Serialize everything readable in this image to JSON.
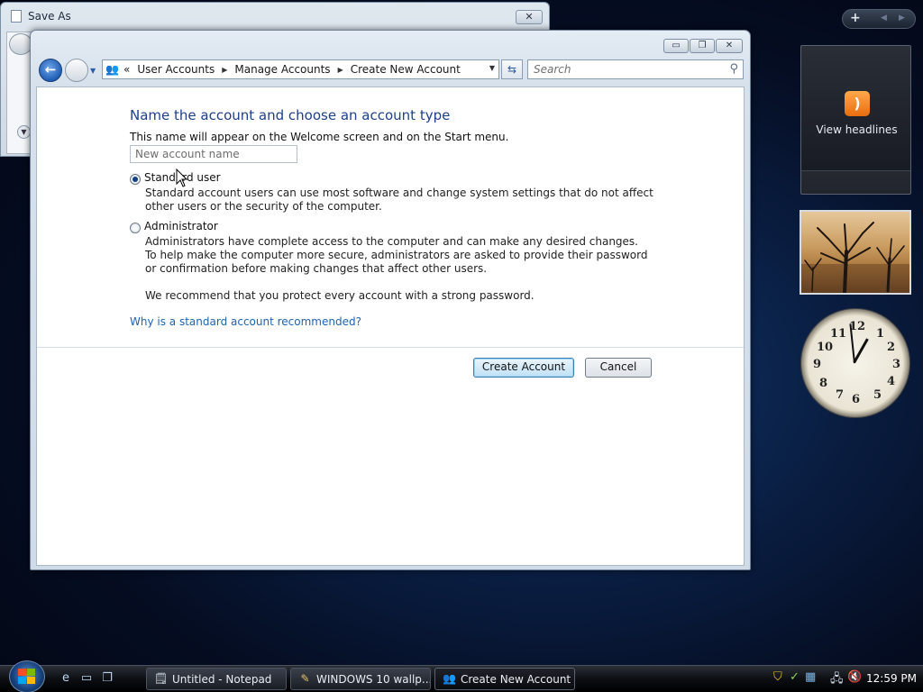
{
  "saveas_window": {
    "title": "Save As"
  },
  "window": {
    "controls": {
      "minimize": "▭",
      "maximize": "❐",
      "close": "✕"
    }
  },
  "address": {
    "crumbs_prefix": "«",
    "crumbs": [
      "User Accounts",
      "Manage Accounts",
      "Create New Account"
    ]
  },
  "search": {
    "placeholder": "Search"
  },
  "form": {
    "heading": "Name the account and choose an account type",
    "subtext": "This name will appear on the Welcome screen and on the Start menu.",
    "name_placeholder": "New account name",
    "options": [
      {
        "label": "Standard user",
        "selected": true,
        "description": "Standard account users can use most software and change system settings that do not affect other users or the security of the computer."
      },
      {
        "label": "Administrator",
        "selected": false,
        "description": "Administrators have complete access to the computer and can make any desired changes. To help make the computer more secure, administrators are asked to provide their password or confirmation before making changes that affect other users."
      }
    ],
    "recommend": "We recommend that you protect every account with a strong password.",
    "link": "Why is a standard account recommended?",
    "create_button": "Create Account",
    "cancel_button": "Cancel"
  },
  "sidebar": {
    "feed_label": "View headlines",
    "clock": {
      "hour": 12,
      "minute": 59
    }
  },
  "taskbar": {
    "items": [
      {
        "label": "Untitled - Notepad",
        "icon": "notepad-icon",
        "active": false
      },
      {
        "label": "WINDOWS 10 wallp...",
        "icon": "paint-icon",
        "active": false
      },
      {
        "label": "Create New Account",
        "icon": "users-icon",
        "active": true
      }
    ],
    "time": "12:59 PM"
  }
}
